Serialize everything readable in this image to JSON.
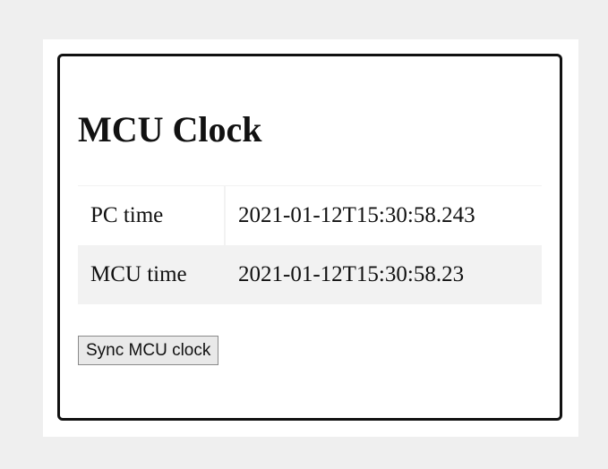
{
  "page": {
    "title": "MCU Clock"
  },
  "rows": [
    {
      "label": "PC time",
      "value": "2021-01-12T15:30:58.243"
    },
    {
      "label": "MCU time",
      "value": "2021-01-12T15:30:58.23"
    }
  ],
  "sync_button": {
    "label": "Sync MCU clock"
  },
  "colors": {
    "page_background": "#efefef",
    "content_background": "#ffffff",
    "card_border": "#111111",
    "alt_row_background": "#f2f2f2",
    "button_background": "#e9e9e9",
    "button_border": "#8a8a8a"
  }
}
